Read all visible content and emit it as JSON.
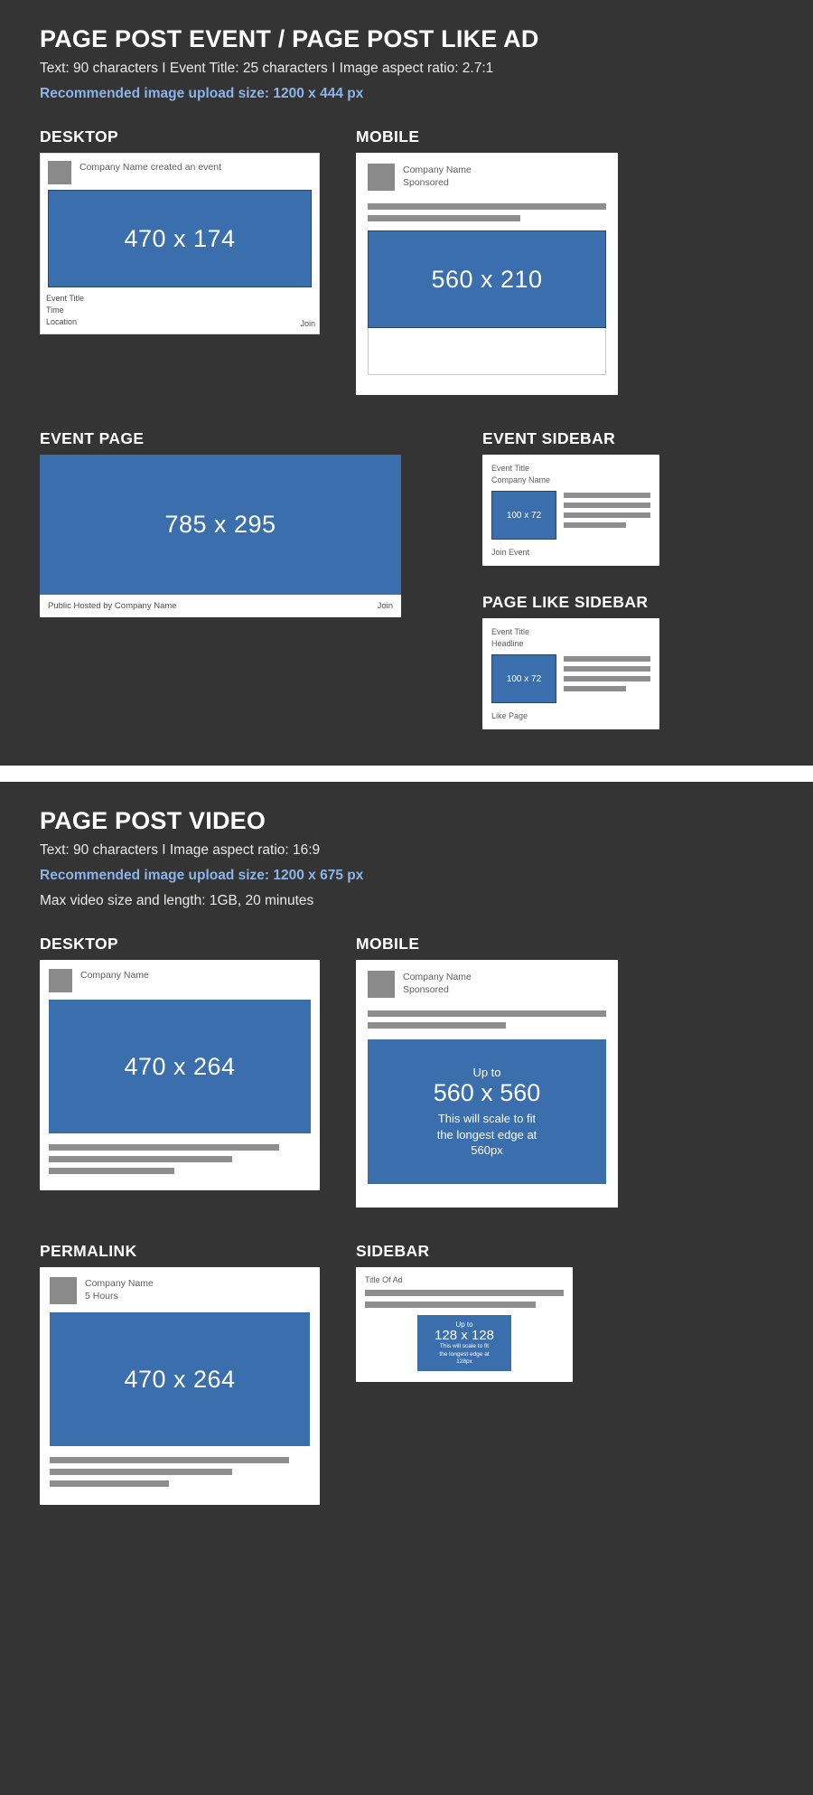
{
  "sections": [
    {
      "title": "PAGE POST EVENT / PAGE POST LIKE AD",
      "meta_specs": "Text: 90 characters I Event Title: 25 characters I Image aspect ratio: 2.7:1",
      "meta_recommended": "Recommended image upload size: 1200 x 444 px",
      "blocks": {
        "desktop_label": "DESKTOP",
        "mobile_label": "MOBILE",
        "event_page_label": "EVENT PAGE",
        "event_sidebar_label": "EVENT SIDEBAR",
        "page_like_sidebar_label": "PAGE LIKE SIDEBAR"
      },
      "desktop": {
        "poster": "Company Name created an event",
        "image_dim": "470 x 174",
        "event_title": "Event Title",
        "event_time": "Time",
        "event_location": "Location",
        "join_label": "Join"
      },
      "mobile": {
        "poster_name": "Company Name",
        "poster_sub": "Sponsored",
        "image_dim": "560 x 210"
      },
      "event_page": {
        "image_dim": "785 x 295",
        "footer_text": "Public Hosted by Company Name",
        "join_label": "Join"
      },
      "event_sidebar": {
        "line1": "Event Title",
        "line2": "Company Name",
        "thumb_dim": "100 x 72",
        "cta": "Join Event"
      },
      "page_like_sidebar": {
        "line1": "Event Title",
        "line2": "Headline",
        "thumb_dim": "100 x 72",
        "cta": "Like Page"
      }
    },
    {
      "title": "PAGE POST VIDEO",
      "meta_specs": "Text: 90 characters I Image aspect ratio: 16:9",
      "meta_recommended": "Recommended image upload size: 1200 x 675 px",
      "meta_extra": "Max video size and length: 1GB, 20 minutes",
      "blocks": {
        "desktop_label": "DESKTOP",
        "mobile_label": "MOBILE",
        "permalink_label": "PERMALINK",
        "sidebar_label": "SIDEBAR"
      },
      "desktop": {
        "poster": "Company Name",
        "image_dim": "470 x 264"
      },
      "mobile": {
        "poster_name": "Company Name",
        "poster_sub": "Sponsored",
        "upto": "Up to",
        "image_dim": "560 x 560",
        "note_line1": "This will scale to fit",
        "note_line2": "the longest edge at",
        "note_line3": "560px"
      },
      "permalink": {
        "poster_name": "Company Name",
        "poster_sub": "5 Hours",
        "image_dim": "470 x 264"
      },
      "sidebar": {
        "title": "Title Of Ad",
        "upto": "Up to",
        "image_dim": "128 x 128",
        "note_line1": "This will scale to fit",
        "note_line2": "the longest edge at",
        "note_line3": "128px"
      }
    }
  ],
  "colors": {
    "background": "#343434",
    "accent_blue": "#3a6ead",
    "highlight_text": "#8cb4e8",
    "card_white": "#ffffff",
    "grey_placeholder": "#8e8e8e"
  }
}
